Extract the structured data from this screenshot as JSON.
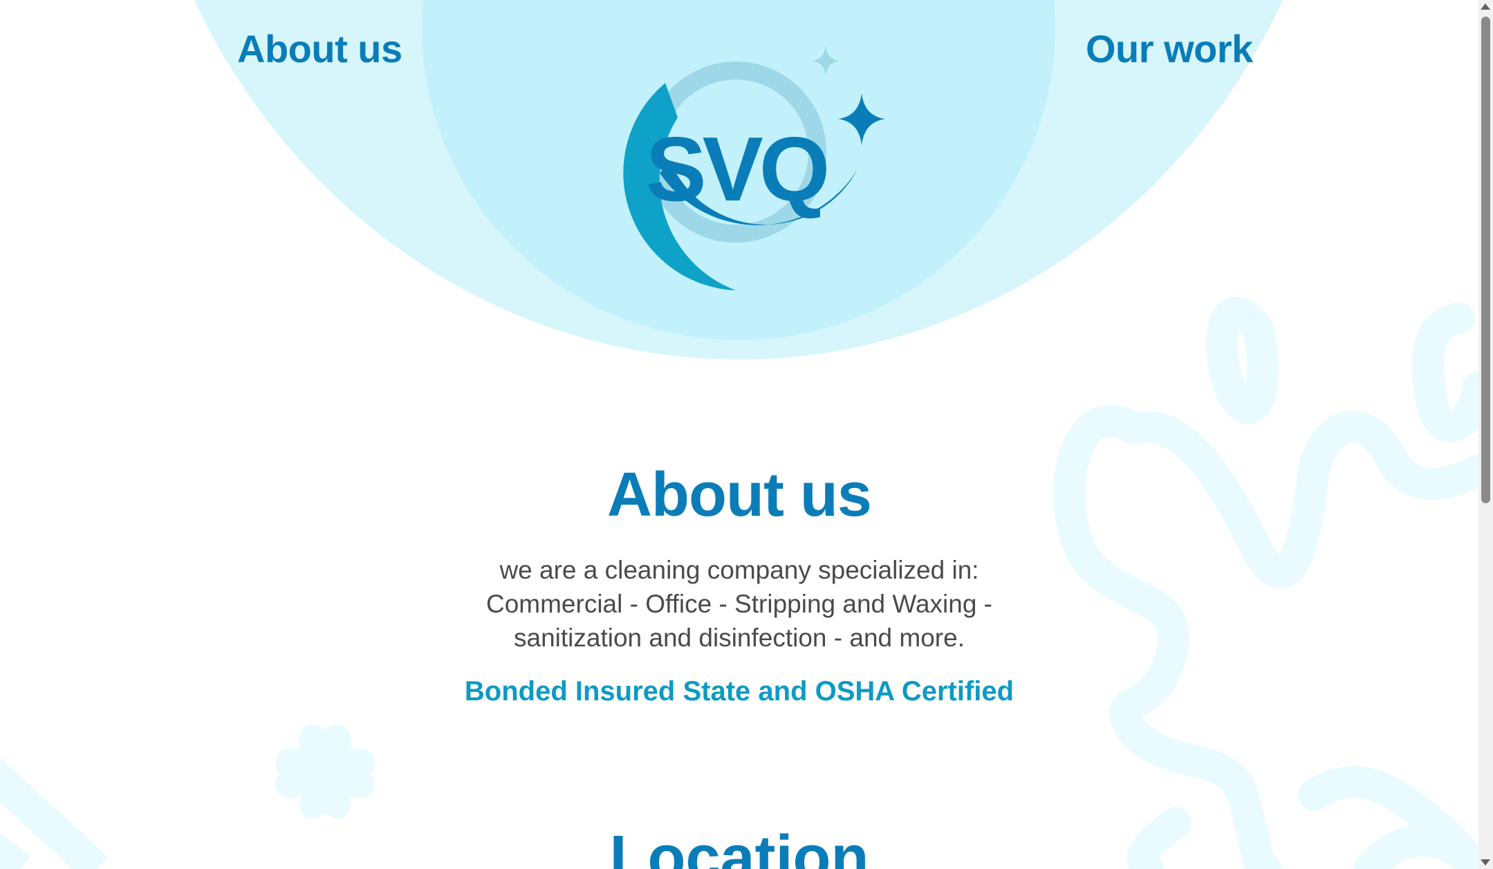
{
  "nav": {
    "about_label": "About us",
    "work_label": "Our work"
  },
  "logo": {
    "text": "SVQ"
  },
  "about": {
    "title": "About us",
    "description_lines": [
      "we are a cleaning company specialized in:",
      "Commercial - Office - Stripping and Waxing -",
      "sanitization and disinfection - and more."
    ],
    "certification": "Bonded Insured State and OSHA Certified"
  },
  "location": {
    "title": "Location"
  },
  "colors": {
    "primary": "#0a7db8",
    "accent": "#0e9ac4",
    "header_outer": "#d6f6fc",
    "header_inner": "#c2f1fb",
    "decor": "#e9fbfe",
    "text": "#4a4a4a"
  }
}
